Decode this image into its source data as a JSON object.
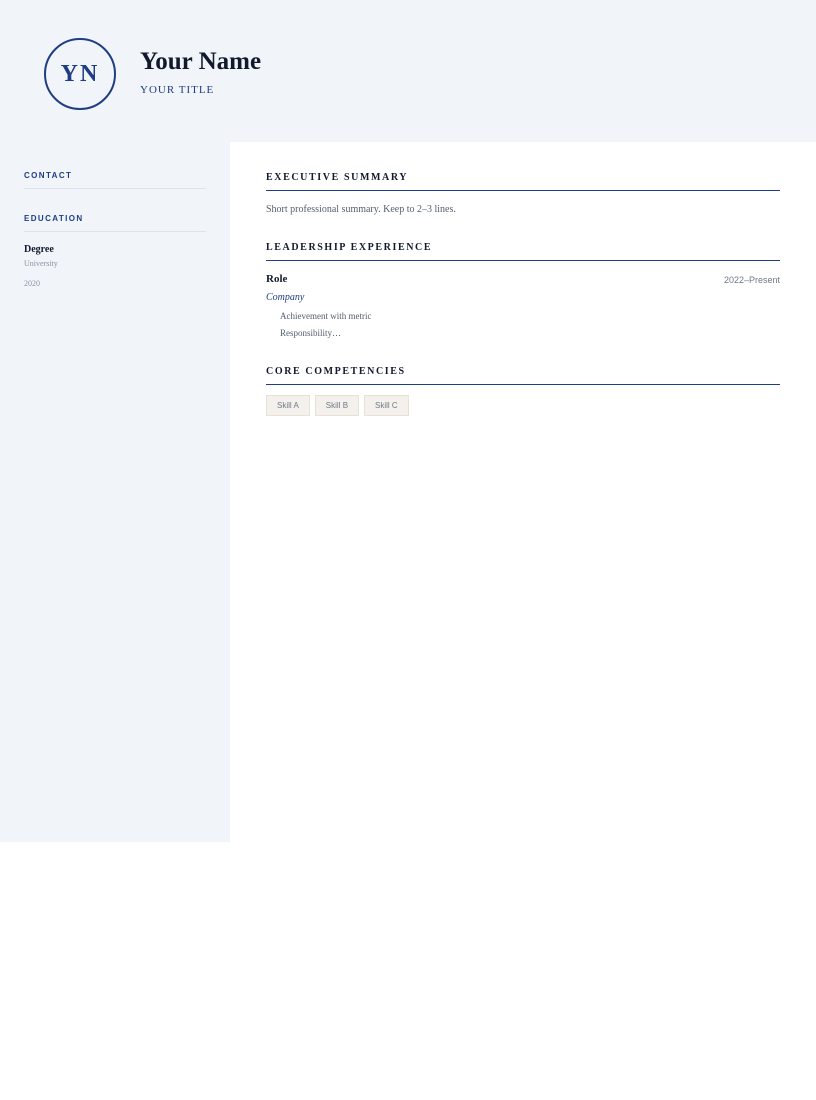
{
  "header": {
    "monogram": "YN",
    "name": "Your Name",
    "title": "YOUR TITLE"
  },
  "sidebar": {
    "contact_heading": "CONTACT",
    "education_heading": "EDUCATION",
    "education": {
      "degree": "Degree",
      "school": "University",
      "year": "2020"
    }
  },
  "main": {
    "summary_heading": "EXECUTIVE SUMMARY",
    "summary_text": "Short professional summary. Keep to 2–3 lines.",
    "experience_heading": "LEADERSHIP EXPERIENCE",
    "experience": {
      "role": "Role",
      "dates": "2022–Present",
      "company": "Company",
      "bullets": [
        "Achievement with metric",
        "Responsibility…"
      ]
    },
    "competencies_heading": "CORE COMPETENCIES",
    "skills": [
      "Skill A",
      "Skill B",
      "Skill C"
    ]
  },
  "colors": {
    "accent": "#1f3d85",
    "panel_background": "#f1f4f9",
    "chip_background": "#f4f1ec"
  }
}
